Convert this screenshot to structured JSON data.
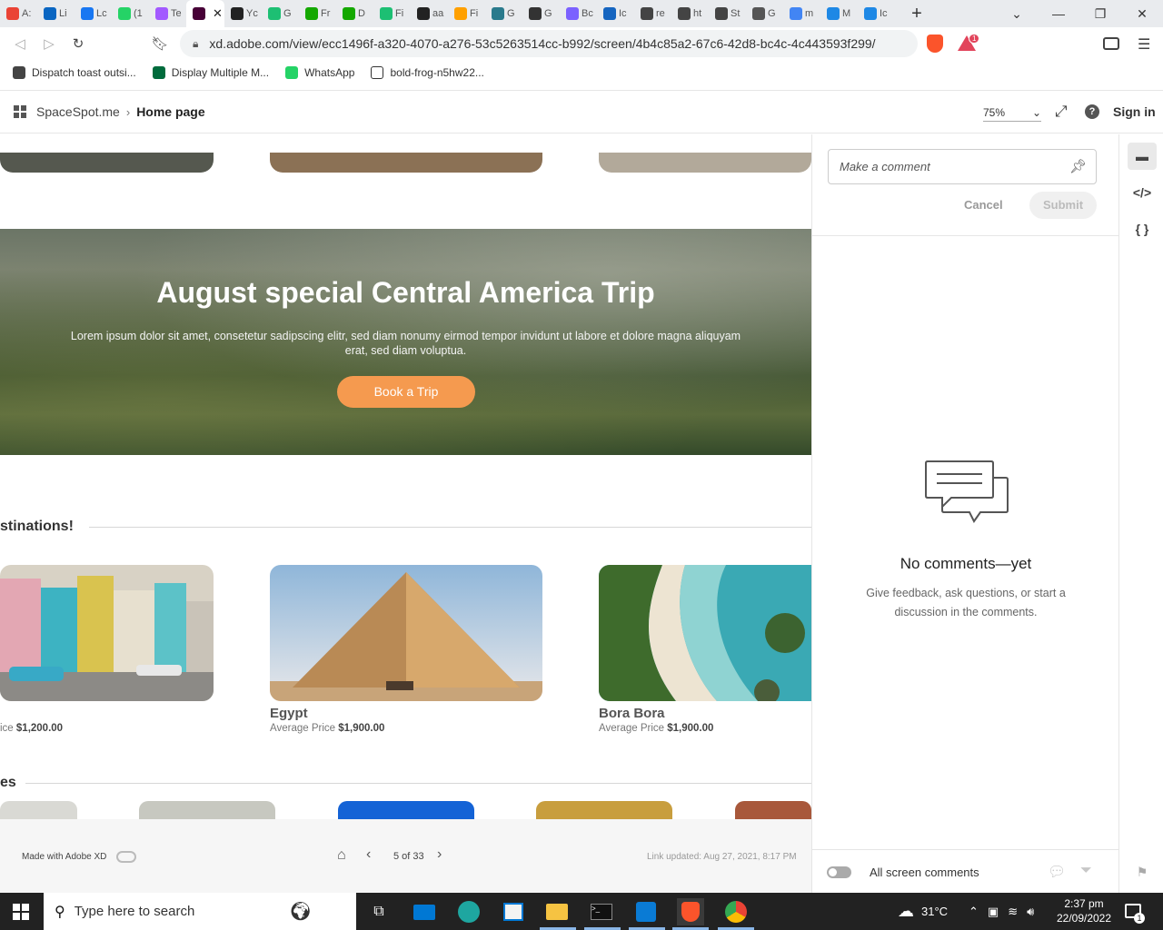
{
  "browser": {
    "tabs": [
      {
        "label": "A:",
        "icon": "gmail-icon",
        "color": "#ea4335"
      },
      {
        "label": "Li",
        "icon": "linkedin-icon",
        "color": "#0a66c2"
      },
      {
        "label": "Lc",
        "icon": "facebook-icon",
        "color": "#1877f2"
      },
      {
        "label": "(1",
        "icon": "whatsapp-icon",
        "color": "#25d366"
      },
      {
        "label": "Te",
        "icon": "figma-icon",
        "color": "#a259ff"
      },
      {
        "label": "",
        "icon": "adobe-xd-icon",
        "color": "#470137",
        "active": true
      },
      {
        "label": "Yc",
        "icon": "github-icon",
        "color": "#222222"
      },
      {
        "label": "G",
        "icon": "fiverr-icon",
        "color": "#1dbf73"
      },
      {
        "label": "Fr",
        "icon": "upwork-icon",
        "color": "#14a800"
      },
      {
        "label": "D",
        "icon": "upwork-icon",
        "color": "#14a800"
      },
      {
        "label": "Fi",
        "icon": "fiverr-icon",
        "color": "#1dbf73"
      },
      {
        "label": "aa",
        "icon": "github-icon",
        "color": "#222222"
      },
      {
        "label": "Fi",
        "icon": "firebase-icon",
        "color": "#ffa000"
      },
      {
        "label": "G",
        "icon": "react-icon",
        "color": "#2a7a8c"
      },
      {
        "label": "G",
        "icon": "nextjs-icon",
        "color": "#333333"
      },
      {
        "label": "Bc",
        "icon": "hashnode-icon",
        "color": "#7b61ff"
      },
      {
        "label": "Ic",
        "icon": "doc-icon",
        "color": "#1565c0"
      },
      {
        "label": "re",
        "icon": "vercel-icon",
        "color": "#444444"
      },
      {
        "label": "ht",
        "icon": "vercel-icon",
        "color": "#444444"
      },
      {
        "label": "St",
        "icon": "vercel-icon",
        "color": "#444444"
      },
      {
        "label": "G",
        "icon": "a-icon",
        "color": "#555555"
      },
      {
        "label": "m",
        "icon": "google-icon",
        "color": "#4285f4"
      },
      {
        "label": "M",
        "icon": "mui-icon",
        "color": "#1e88e5"
      },
      {
        "label": "Ic",
        "icon": "mui-icon",
        "color": "#1e88e5"
      }
    ],
    "active_tab_close": "✕",
    "url": "xd.adobe.com/view/ecc1496f-a320-4070-a276-53c5263514cc-b992/screen/4b4c85a2-67c6-42d8-bc4c-4c443593f299/",
    "brave_badge": "1",
    "bookmarks": [
      {
        "label": "Dispatch toast outsi...",
        "icon": "bookmark-icon",
        "color": "#444444"
      },
      {
        "label": "Display Multiple M...",
        "icon": "ti-icon",
        "color": "#006b3c"
      },
      {
        "label": "WhatsApp",
        "icon": "whatsapp-icon",
        "color": "#25d366"
      },
      {
        "label": "bold-frog-n5hw22...",
        "icon": "page-icon",
        "color": "#ffffff"
      }
    ]
  },
  "xd": {
    "breadcrumb_root": "SpaceSpot.me",
    "breadcrumb_current": "Home page",
    "zoom": "75%",
    "sign_in": "Sign in"
  },
  "artboard": {
    "hero_title": "August special Central America Trip",
    "hero_text": "Lorem ipsum dolor sit amet, consetetur sadipscing elitr, sed diam nonumy eirmod tempor invidunt ut labore et dolore magna aliquyam erat, sed diam voluptua.",
    "hero_button": "Book a Trip",
    "section_destinations": "stinations!",
    "section_bottom": "es",
    "destinations": [
      {
        "name": "",
        "price_prefix": "ice ",
        "price": "$1,200.00"
      },
      {
        "name": "Egypt",
        "price_prefix": "Average Price ",
        "price": "$1,900.00"
      },
      {
        "name": "Bora Bora",
        "price_prefix": "Average Price ",
        "price": "$1,900.00"
      }
    ]
  },
  "footer": {
    "made_with": "Made with Adobe XD",
    "pager": "5 of 33",
    "link_updated": "Link updated: Aug 27, 2021, 8:17 PM"
  },
  "comments": {
    "placeholder": "Make a comment",
    "cancel": "Cancel",
    "submit": "Submit",
    "empty_title": "No comments—yet",
    "empty_text": "Give feedback, ask questions, or start a discussion in the comments.",
    "all_screen": "All screen comments"
  },
  "taskbar": {
    "search_placeholder": "Type here to search",
    "temperature": "31°C",
    "time": "2:37 pm",
    "date": "22/09/2022",
    "notifications": "1"
  }
}
